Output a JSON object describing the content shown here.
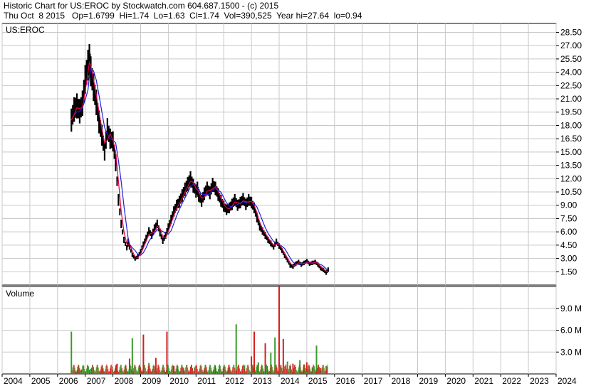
{
  "header": {
    "line1": "Historic Chart for US:EROC by Stockwatch.com 604.687.1500 - (c) 2015",
    "line2": "Thu Oct  8 2015   Op=1.6799  Hi=1.74  Lo=1.63  Cl=1.74  Vol=390,525  Year hi=27.64  lo=0.94"
  },
  "symbol_label": "US:EROC",
  "volume_label": "Volume",
  "colors": {
    "price_bar": "#000000",
    "short_ma": "#e0004a",
    "long_ma": "#1f1fd6",
    "volume_up": "#3a9a2a",
    "volume_down": "#d81e1e",
    "grid": "#c8c8c8"
  },
  "chart_data": {
    "type": "line",
    "price_axis": {
      "ticks": [
        "28.50",
        "27.00",
        "25.50",
        "24.00",
        "22.50",
        "21.00",
        "19.50",
        "18.00",
        "16.50",
        "15.00",
        "13.50",
        "12.00",
        "10.50",
        "9.00",
        "7.50",
        "6.00",
        "4.50",
        "3.00",
        "1.50"
      ],
      "range": [
        0,
        29.5
      ]
    },
    "volume_axis": {
      "ticks": [
        "9.0 M",
        "6.0 M",
        "3.0 M"
      ],
      "range": [
        0,
        12000000
      ]
    },
    "x_axis": {
      "labels": [
        "2004",
        "2005",
        "2006",
        "2007",
        "2008",
        "2009",
        "2010",
        "2011",
        "2012",
        "2013",
        "2014",
        "2015",
        "2016",
        "2017",
        "2018",
        "2019",
        "2020",
        "2021",
        "2022",
        "2023",
        "2024"
      ],
      "range": [
        2004,
        2024
      ]
    },
    "series": [
      {
        "x": [
          2006.5,
          2006.6,
          2006.7,
          2006.8,
          2006.9,
          2007.0,
          2007.1,
          2007.15,
          2007.2,
          2007.3,
          2007.4,
          2007.5,
          2007.6,
          2007.7,
          2007.8,
          2007.9,
          2008.0,
          2008.1,
          2008.2,
          2008.3,
          2008.4,
          2008.5,
          2008.55,
          2008.6,
          2008.7,
          2008.8,
          2008.9,
          2009.0,
          2009.1,
          2009.2,
          2009.3,
          2009.4,
          2009.5,
          2009.6,
          2009.7,
          2009.8,
          2009.9,
          2010.0,
          2010.1,
          2010.2,
          2010.3,
          2010.4,
          2010.5,
          2010.6,
          2010.7,
          2010.8,
          2010.9,
          2011.0,
          2011.05,
          2011.1,
          2011.2,
          2011.3,
          2011.4,
          2011.5,
          2011.6,
          2011.7,
          2011.8,
          2011.9,
          2012.0,
          2012.1,
          2012.2,
          2012.3,
          2012.4,
          2012.5,
          2012.6,
          2012.7,
          2012.8,
          2012.9,
          2013.0,
          2013.1,
          2013.2,
          2013.3,
          2013.4,
          2013.5,
          2013.6,
          2013.7,
          2013.8,
          2013.9,
          2014.0,
          2014.1,
          2014.2,
          2014.3,
          2014.4,
          2014.5,
          2014.6,
          2014.7,
          2014.8,
          2014.9,
          2015.0,
          2015.1,
          2015.2,
          2015.3,
          2015.4,
          2015.5,
          2015.6,
          2015.7,
          2015.77
        ],
        "y": [
          18.6,
          19.8,
          20.2,
          19.6,
          20.5,
          23.2,
          24.8,
          25.4,
          24.1,
          22.3,
          20.6,
          18.4,
          16.9,
          15.1,
          17.6,
          16.5,
          16.2,
          13.8,
          9.6,
          6.9,
          5.1,
          4.2,
          4.9,
          4.3,
          3.4,
          3.0,
          3.2,
          3.8,
          4.6,
          5.3,
          6.1,
          5.6,
          6.4,
          6.9,
          5.9,
          5.0,
          5.6,
          6.5,
          7.4,
          8.3,
          9.0,
          9.4,
          10.1,
          10.8,
          11.4,
          12.0,
          11.2,
          10.6,
          10.9,
          10.1,
          9.5,
          10.3,
          10.9,
          10.4,
          11.3,
          10.9,
          10.2,
          9.5,
          8.9,
          8.5,
          8.7,
          9.1,
          9.6,
          9.0,
          9.3,
          9.7,
          9.1,
          9.6,
          9.3,
          8.7,
          7.6,
          6.6,
          6.1,
          5.6,
          5.1,
          4.7,
          4.3,
          4.9,
          4.4,
          3.9,
          3.3,
          2.8,
          2.2,
          2.1,
          2.4,
          2.6,
          2.3,
          2.5,
          2.7,
          2.4,
          2.5,
          2.6,
          2.3,
          1.9,
          1.7,
          1.4,
          1.74
        ]
      }
    ],
    "volume": {
      "x": [
        2006.5,
        2006.85,
        2007.2,
        2007.6,
        2007.9,
        2008.15,
        2008.3,
        2008.6,
        2008.7,
        2008.95,
        2009.1,
        2009.3,
        2009.55,
        2009.8,
        2009.95,
        2010.2,
        2010.55,
        2010.95,
        2011.3,
        2011.7,
        2012.0,
        2012.2,
        2012.45,
        2012.75,
        2013.0,
        2013.1,
        2013.25,
        2013.5,
        2013.7,
        2013.85,
        2014.0,
        2014.15,
        2014.3,
        2014.5,
        2014.75,
        2014.9,
        2015.0,
        2015.2,
        2015.35,
        2015.5,
        2015.7
      ],
      "v": [
        5800000,
        500000,
        700000,
        600000,
        300000,
        1400000,
        600000,
        2100000,
        4900000,
        1100000,
        5400000,
        1500000,
        2200000,
        500000,
        5800000,
        1100000,
        800000,
        900000,
        600000,
        900000,
        1000000,
        800000,
        6800000,
        1200000,
        2400000,
        5800000,
        1600000,
        4200000,
        2900000,
        5000000,
        12200000,
        4800000,
        1700000,
        1400000,
        1900000,
        1300000,
        1600000,
        900000,
        3900000,
        800000,
        1100000
      ],
      "up": [
        true,
        false,
        true,
        false,
        false,
        false,
        true,
        false,
        true,
        false,
        false,
        true,
        false,
        true,
        false,
        false,
        true,
        true,
        false,
        false,
        true,
        false,
        true,
        true,
        false,
        false,
        true,
        false,
        true,
        true,
        false,
        false,
        true,
        false,
        true,
        false,
        false,
        true,
        true,
        false,
        true
      ]
    }
  }
}
